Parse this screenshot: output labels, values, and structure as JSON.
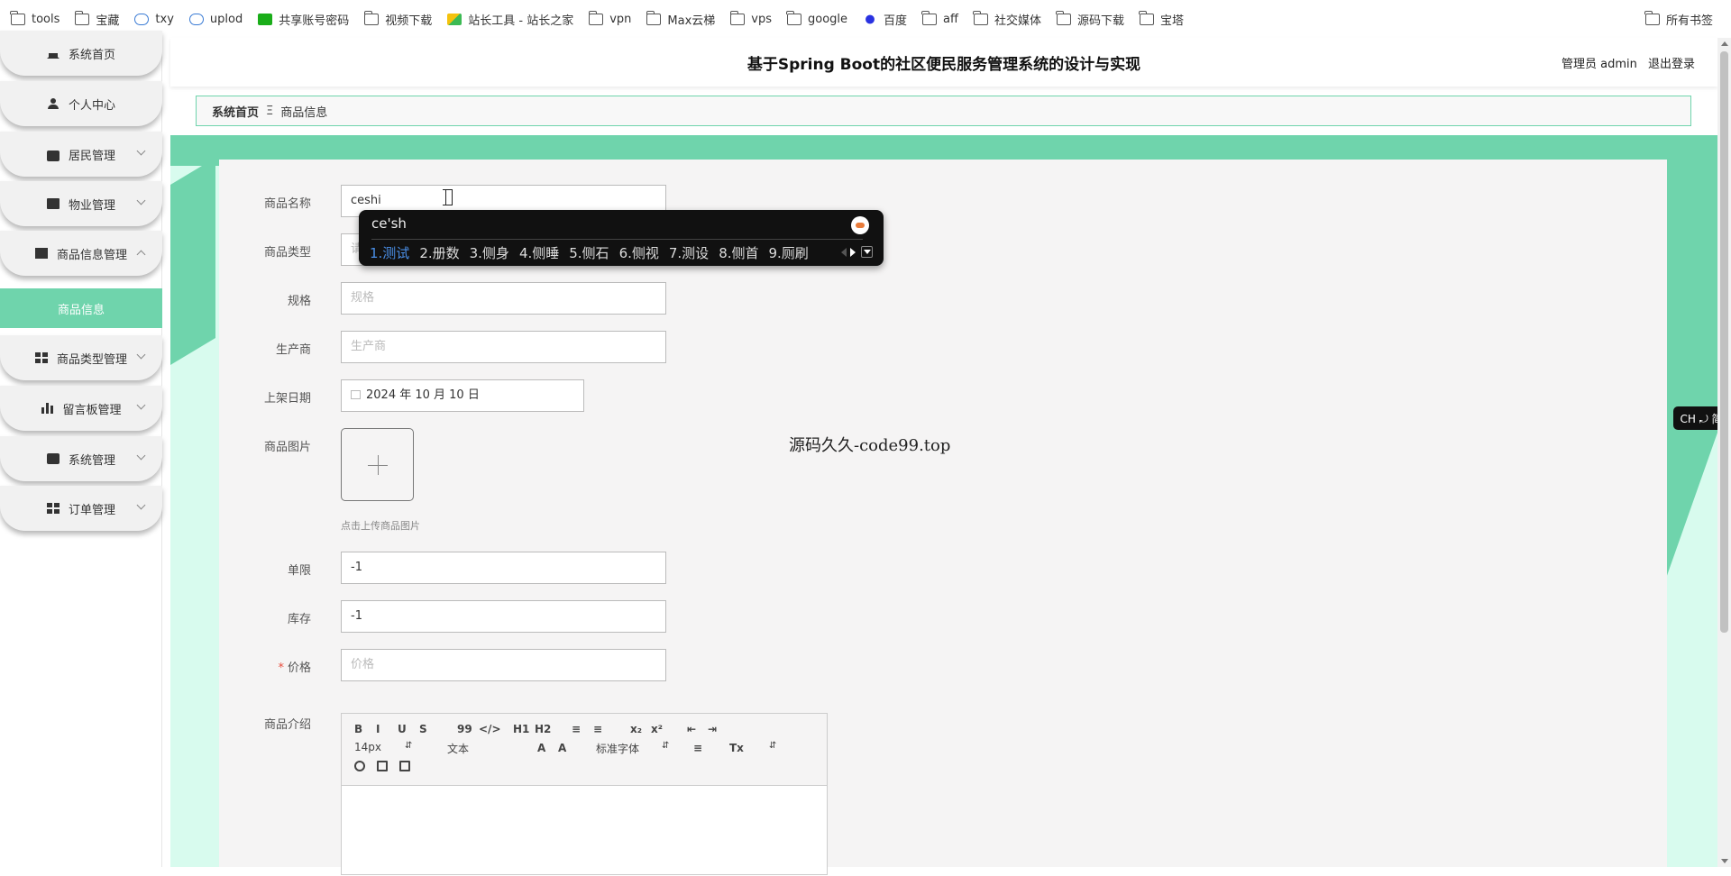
{
  "bookmarks": [
    {
      "label": "tools",
      "icon": "folder-icon"
    },
    {
      "label": "宝藏",
      "icon": "folder-icon"
    },
    {
      "label": "txy",
      "icon": "cloud-icon"
    },
    {
      "label": "uplod",
      "icon": "cloud-icon"
    },
    {
      "label": "共享账号密码",
      "icon": "green-doc-icon"
    },
    {
      "label": "视频下载",
      "icon": "folder-icon"
    },
    {
      "label": "站长工具 - 站长之家",
      "icon": "tools-icon"
    },
    {
      "label": "vpn",
      "icon": "folder-icon"
    },
    {
      "label": "Max云梯",
      "icon": "folder-icon"
    },
    {
      "label": "vps",
      "icon": "folder-icon"
    },
    {
      "label": "google",
      "icon": "folder-icon"
    },
    {
      "label": "百度",
      "icon": "baidu-icon"
    },
    {
      "label": "aff",
      "icon": "folder-icon"
    },
    {
      "label": "社交媒体",
      "icon": "folder-icon"
    },
    {
      "label": "源码下载",
      "icon": "folder-icon"
    },
    {
      "label": "宝塔",
      "icon": "folder-icon"
    }
  ],
  "all_bookmarks_label": "所有书签",
  "sidebar": {
    "items": [
      {
        "label": "系统首页",
        "icon": "home-icon"
      },
      {
        "label": "个人中心",
        "icon": "user-icon"
      },
      {
        "label": "居民管理",
        "icon": "briefcase-icon"
      },
      {
        "label": "物业管理",
        "icon": "clipboard-icon"
      },
      {
        "label": "商品信息管理",
        "icon": "monitor-icon"
      },
      {
        "label": "商品类型管理",
        "icon": "grid-icon"
      },
      {
        "label": "留言板管理",
        "icon": "bar-chart-icon"
      },
      {
        "label": "系统管理",
        "icon": "chat-icon"
      },
      {
        "label": "订单管理",
        "icon": "grid-icon"
      }
    ],
    "active_sub": "商品信息"
  },
  "header": {
    "title": "基于Spring Boot的社区便民服务管理系统的设计与实现",
    "user": "管理员 admin",
    "logout": "退出登录"
  },
  "breadcrumb": {
    "home": "系统首页",
    "current": "商品信息"
  },
  "form": {
    "name": {
      "label": "商品名称",
      "value": "ceshi"
    },
    "type": {
      "label": "商品类型",
      "placeholder": "请"
    },
    "spec": {
      "label": "规格",
      "placeholder": "规格"
    },
    "maker": {
      "label": "生产商",
      "placeholder": "生产商"
    },
    "date": {
      "label": "上架日期",
      "value": "2024 年 10 月 10 日"
    },
    "image": {
      "label": "商品图片",
      "hint": "点击上传商品图片"
    },
    "limit": {
      "label": "单限",
      "value": "-1"
    },
    "stock": {
      "label": "库存",
      "value": "-1"
    },
    "price": {
      "label": "价格",
      "placeholder": "价格",
      "required_mark": "*"
    },
    "intro": {
      "label": "商品介绍"
    }
  },
  "editor": {
    "row1": [
      "B",
      "I",
      "U",
      "S",
      "99",
      "</>",
      "H1",
      "H2",
      "≡",
      "≡",
      "x₂",
      "x²",
      "⇤",
      "⇥"
    ],
    "font_size": "14px",
    "block_type": "文本",
    "font_family": "标准字体",
    "row2_icons": [
      "A",
      "A",
      "≡",
      "Tx"
    ],
    "row3_icons": [
      "link-icon",
      "image-icon",
      "video-icon"
    ]
  },
  "watermark": "源码久久-code99.top",
  "ime": {
    "input": "ce'sh",
    "candidates": [
      "1.测试",
      "2.册数",
      "3.侧身",
      "4.侧睡",
      "5.侧石",
      "6.侧视",
      "7.测设",
      "8.侧首",
      "9.厕刷"
    ]
  },
  "ch_badge": "CH ⤾ 简"
}
